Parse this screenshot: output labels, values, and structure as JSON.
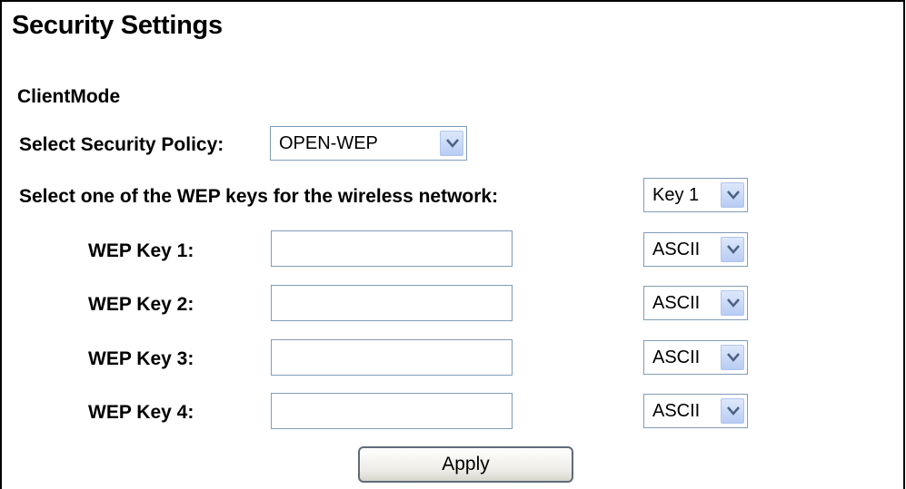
{
  "page": {
    "title": "Security Settings",
    "section": "ClientMode"
  },
  "policy": {
    "label": "Select Security Policy:",
    "value": "OPEN-WEP"
  },
  "wep_select": {
    "label": "Select one of the WEP keys for the wireless network:",
    "value": "Key 1"
  },
  "keys": [
    {
      "label": "WEP Key 1:",
      "value": "",
      "format": "ASCII"
    },
    {
      "label": "WEP Key 2:",
      "value": "",
      "format": "ASCII"
    },
    {
      "label": "WEP Key 3:",
      "value": "",
      "format": "ASCII"
    },
    {
      "label": "WEP Key 4:",
      "value": "",
      "format": "ASCII"
    }
  ],
  "buttons": {
    "apply": "Apply"
  },
  "icons": {
    "dropdown": "chevron-down-icon"
  },
  "colors": {
    "border": "#7f9db9",
    "arrow_bg": "#c9d8f6"
  }
}
